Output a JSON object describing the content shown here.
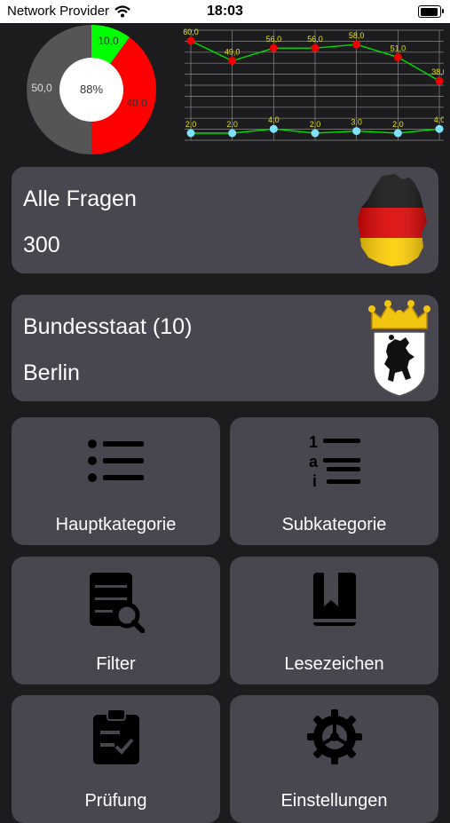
{
  "status_bar": {
    "carrier": "Network Provider",
    "time": "18:03"
  },
  "pie": {
    "center_label": "88%",
    "slices": [
      {
        "label": "10,0",
        "value": 10,
        "color": "#00ff00"
      },
      {
        "label": "40,0",
        "value": 40,
        "color": "#ff0000"
      },
      {
        "label": "50,0",
        "value": 50,
        "color": "#555555"
      }
    ]
  },
  "line_chart": {
    "upper": {
      "labels": [
        "60,0",
        "49,0",
        "56,0",
        "56,0",
        "58,0",
        "51,0",
        "38,0"
      ],
      "values": [
        60,
        49,
        56,
        56,
        58,
        51,
        38
      ]
    },
    "lower": {
      "labels": [
        "2,0",
        "2,0",
        "4,0",
        "2,0",
        "3,0",
        "2,0",
        "4,0"
      ],
      "values": [
        2,
        2,
        4,
        2,
        3,
        2,
        4
      ]
    }
  },
  "all_questions": {
    "title": "Alle Fragen",
    "count": "300"
  },
  "state": {
    "title": "Bundesstaat (10)",
    "name": "Berlin"
  },
  "tiles": {
    "main_category": "Hauptkategorie",
    "sub_category": "Subkategorie",
    "filter": "Filter",
    "bookmarks": "Lesezeichen",
    "exams": "Prüfung",
    "settings": "Einstellungen"
  }
}
